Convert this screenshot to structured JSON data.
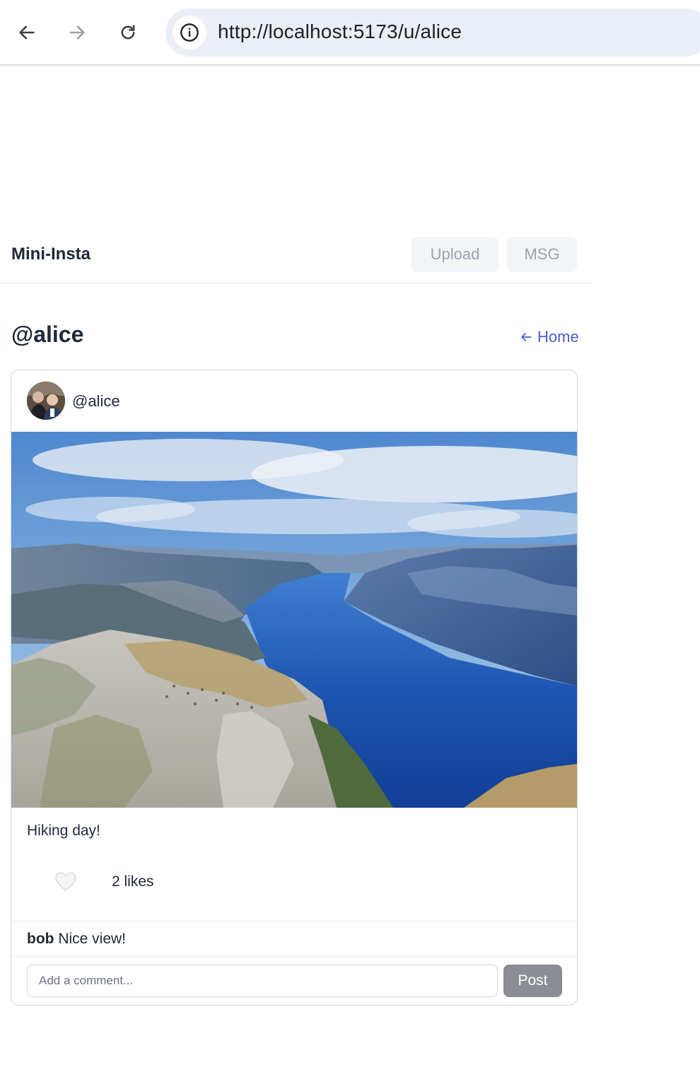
{
  "browser": {
    "url": "http://localhost:5173/u/alice",
    "icons": [
      "back-arrow-icon",
      "forward-arrow-icon",
      "reload-icon",
      "info-icon"
    ]
  },
  "header": {
    "brand": "Mini-Insta",
    "upload_label": "Upload",
    "msg_label": "MSG"
  },
  "profile": {
    "title": "@alice",
    "home_link": "Home",
    "home_icon": "arrow-left-icon"
  },
  "post": {
    "author": "@alice",
    "caption": "Hiking day!",
    "likes_text": "2 likes",
    "like_icon": "white-heart-icon",
    "comments": [
      {
        "user": "bob",
        "text": "Nice view!"
      }
    ],
    "comment_placeholder": "Add a comment...",
    "post_button": "Post"
  },
  "colors": {
    "link": "#4f5bd5",
    "disabled_button_bg": "#f3f4f6",
    "disabled_button_text": "#9ca3af",
    "post_button_bg": "#8a8d92"
  }
}
